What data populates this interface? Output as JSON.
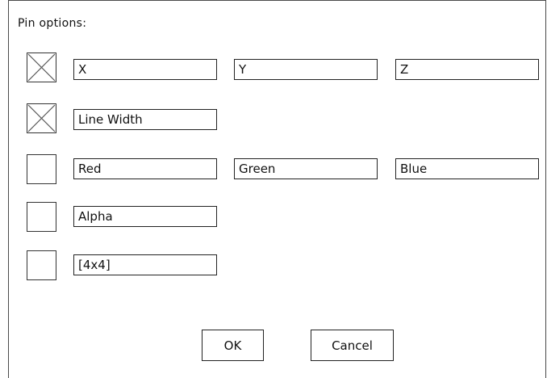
{
  "dialog": {
    "title": "Pin options:"
  },
  "rows": [
    {
      "checked": true,
      "fields": [
        "X",
        "Y",
        "Z"
      ]
    },
    {
      "checked": true,
      "fields": [
        "Line Width"
      ]
    },
    {
      "checked": false,
      "fields": [
        "Red",
        "Green",
        "Blue"
      ]
    },
    {
      "checked": false,
      "fields": [
        "Alpha"
      ]
    },
    {
      "checked": false,
      "fields": [
        "[4x4]"
      ]
    }
  ],
  "buttons": {
    "ok_label": "OK",
    "cancel_label": "Cancel"
  },
  "colors": {
    "border": "#222222",
    "background": "#ffffff",
    "check_mark": "#555555"
  }
}
